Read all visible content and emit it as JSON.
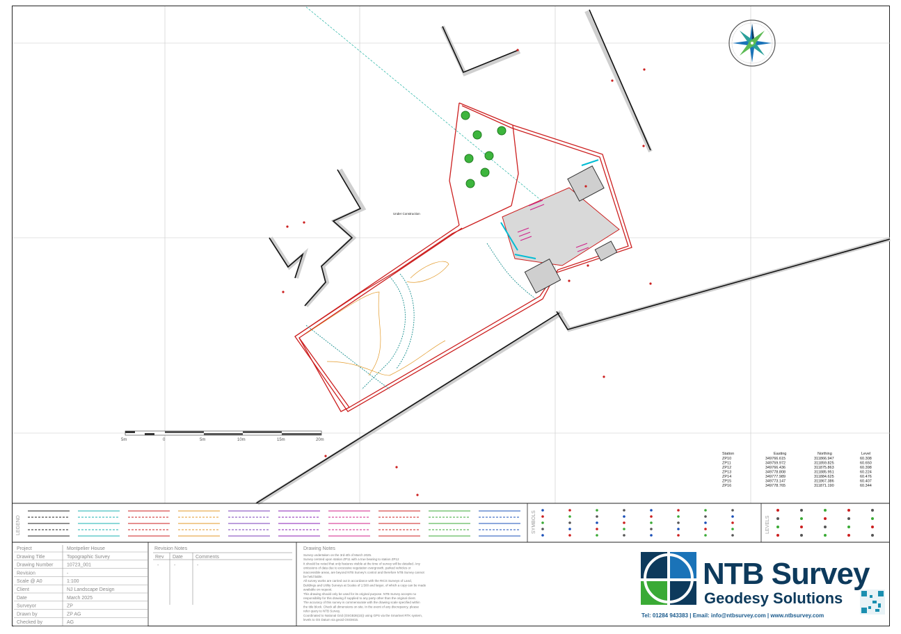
{
  "map": {
    "site_label": "Under Construction"
  },
  "scale_bar": {
    "ticks": [
      "5m",
      "0",
      "5m",
      "10m",
      "15m",
      "20m"
    ]
  },
  "stations_table": {
    "headers": [
      "Station",
      "Easting",
      "Northing",
      "Level"
    ],
    "rows": [
      [
        "ZP10",
        "349766.615",
        "311866.947",
        "60.308"
      ],
      [
        "ZP11",
        "349759.972",
        "311859.825",
        "60.650"
      ],
      [
        "ZP12",
        "349766.436",
        "311875.863",
        "60.398"
      ],
      [
        "ZP13",
        "349778.808",
        "311885.951",
        "60.224"
      ],
      [
        "ZP14",
        "349777.989",
        "311884.625",
        "60.476"
      ],
      [
        "ZP15",
        "349773.147",
        "311867.386",
        "60.407"
      ],
      [
        "ZP16",
        "349778.765",
        "311871.190",
        "60.344"
      ]
    ]
  },
  "legend": {
    "section_label": "LEGEND",
    "symbols_label": "SYMBOLS",
    "levels_label": "LEVELS"
  },
  "title_block": {
    "rows": [
      {
        "label": "Project",
        "value": "Montpelier House"
      },
      {
        "label": "Drawing Title",
        "value": "Topographic Survey"
      },
      {
        "label": "Drawing Number",
        "value": "10723_001"
      },
      {
        "label": "Revision",
        "value": "-"
      },
      {
        "label": "Scale @ A0",
        "value": "1:100"
      },
      {
        "label": "Client",
        "value": "NJ Landscape Design"
      },
      {
        "label": "Date",
        "value": "March 2025"
      },
      {
        "label": "Surveyor",
        "value": "ZP"
      },
      {
        "label": "Drawn by",
        "value": "ZP AG"
      },
      {
        "label": "Checked by",
        "value": "AG"
      }
    ]
  },
  "revision_notes": {
    "title": "Revision Notes",
    "headers": [
      "Rev",
      "Date",
      "Comments"
    ],
    "row": [
      "-",
      "-",
      "-"
    ]
  },
  "drawing_notes": {
    "title": "Drawing Notes",
    "lines": [
      "Survey undertaken on the 3rd-4th of March 2025.",
      "Survey centred upon station ZP11 with a true bearing to station ZP12",
      "It should be noted that only features visible at the time of survey will be detailed. Any",
      "omissions of data due to excessive vegetation overgrowth, parked vehicles or",
      "inaccessible areas, are beyond NTB Survey's control and therefore NTB Survey cannot",
      "be held liable.",
      "All survey works are carried out in accordance with the RICS Surveys of Land,",
      "Buildings and Utility Surveys at Scales of 1:500 and larger, of which a copy can be made",
      "available on request.",
      "This drawing should only be used for its original purpose. NTB Survey accepts no",
      "responsibility for this drawing if supplied to any party other than the original client.",
      "The accuracy of this survey is commensurate with the drawing scale specified within",
      "the title block. Check all dimensions on site. In the event of any discrepancy, please",
      "refer query to NTB Survey.",
      "Coordinated to National Grid (OSGB36(15)) using GPS via the Smartnet RTK system,",
      "levels to OS Datum via geoid OSGM15."
    ]
  },
  "brand": {
    "name": "NTB Survey",
    "tagline": "Geodesy Solutions",
    "contact": "Tel: 01284 943383 | Email: info@ntbsurvey.com | www.ntbsurvey.com",
    "colors": {
      "navy": "#0d3a5c",
      "green": "#3aaa35",
      "blue": "#1a73b8",
      "teal": "#1ab0b0"
    }
  }
}
